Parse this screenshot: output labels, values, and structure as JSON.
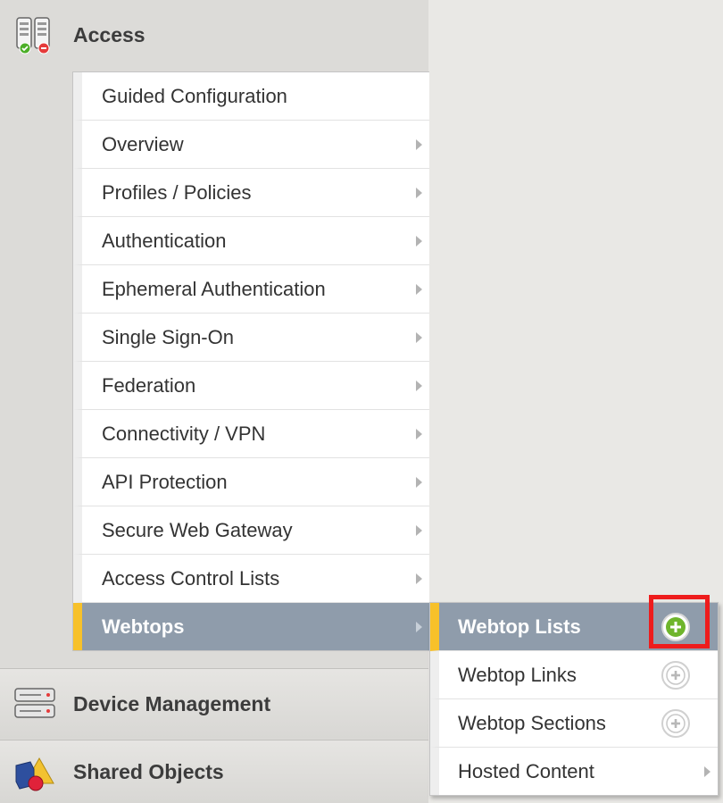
{
  "sidebar": {
    "sections": {
      "access": {
        "label": "Access"
      },
      "device_management": {
        "label": "Device Management"
      },
      "shared_objects": {
        "label": "Shared Objects"
      }
    }
  },
  "access_menu": {
    "items": [
      {
        "label": "Guided Configuration",
        "has_submenu": false
      },
      {
        "label": "Overview",
        "has_submenu": true
      },
      {
        "label": "Profiles / Policies",
        "has_submenu": true
      },
      {
        "label": "Authentication",
        "has_submenu": true
      },
      {
        "label": "Ephemeral Authentication",
        "has_submenu": true
      },
      {
        "label": "Single Sign-On",
        "has_submenu": true
      },
      {
        "label": "Federation",
        "has_submenu": true
      },
      {
        "label": "Connectivity / VPN",
        "has_submenu": true
      },
      {
        "label": "API Protection",
        "has_submenu": true
      },
      {
        "label": "Secure Web Gateway",
        "has_submenu": true
      },
      {
        "label": "Access Control Lists",
        "has_submenu": true
      },
      {
        "label": "Webtops",
        "has_submenu": true,
        "active": true
      }
    ]
  },
  "webtops_submenu": {
    "items": [
      {
        "label": "Webtop Lists",
        "action": "add-icon",
        "active": true,
        "highlighted": true
      },
      {
        "label": "Webtop Links",
        "action": "add-icon"
      },
      {
        "label": "Webtop Sections",
        "action": "add-icon"
      },
      {
        "label": "Hosted Content",
        "action": "submenu-arrow"
      }
    ]
  },
  "colors": {
    "active_bg": "#8f9cab",
    "active_marker": "#f7c12a",
    "highlight": "#ee1c1c",
    "add_green": "#6fb52c"
  }
}
